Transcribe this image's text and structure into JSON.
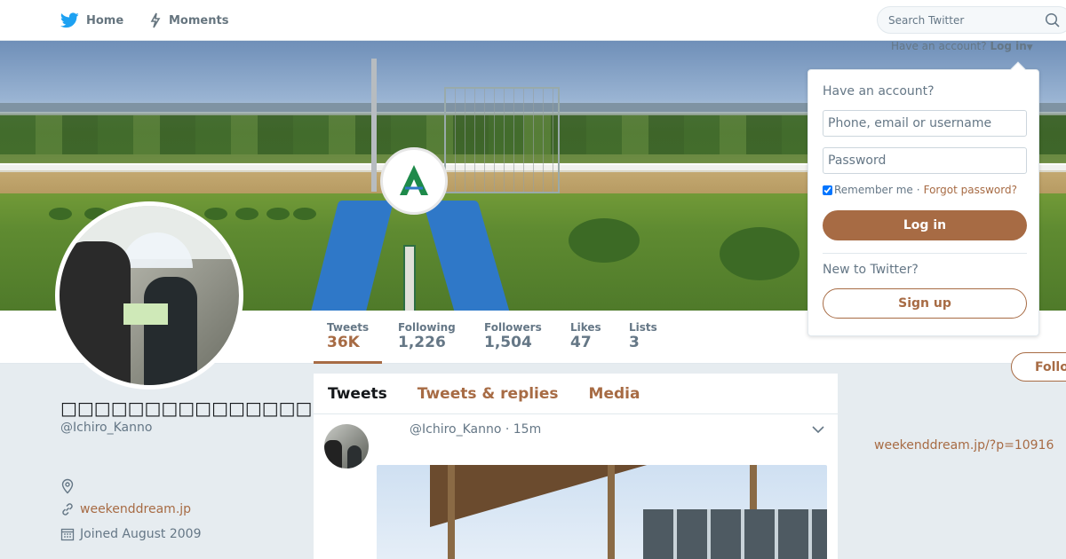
{
  "nav": {
    "home_label": "Home",
    "moments_label": "Moments",
    "search_placeholder": "Search Twitter"
  },
  "login_hint": {
    "prefix": "Have an account?",
    "login_label": "Log in"
  },
  "login_panel": {
    "title": "Have an account?",
    "username_placeholder": "Phone, email or username",
    "password_placeholder": "Password",
    "remember_label": "Remember me",
    "separator": "·",
    "forgot_label": "Forgot password?",
    "login_button": "Log in",
    "new_label": "New to Twitter?",
    "signup_button": "Sign up"
  },
  "stats": [
    {
      "label": "Tweets",
      "value": "36K"
    },
    {
      "label": "Following",
      "value": "1,226"
    },
    {
      "label": "Followers",
      "value": "1,504"
    },
    {
      "label": "Likes",
      "value": "47"
    },
    {
      "label": "Lists",
      "value": "3"
    }
  ],
  "follow_button": "Follo",
  "profile": {
    "name": "□□□□□□□□□□□□□□□□□□□□□",
    "handle": "@Ichiro_Kanno",
    "website": "weekenddream.jp",
    "joined": "Joined August 2009"
  },
  "timeline": {
    "tabs": [
      "Tweets",
      "Tweets & replies",
      "Media"
    ],
    "tweet_header": "@Ichiro_Kanno · 15m"
  },
  "right_link": "weekenddream.jp/?p=10916",
  "colors": {
    "accent": "#a76b44",
    "twitter_blue": "#1da1f2"
  }
}
